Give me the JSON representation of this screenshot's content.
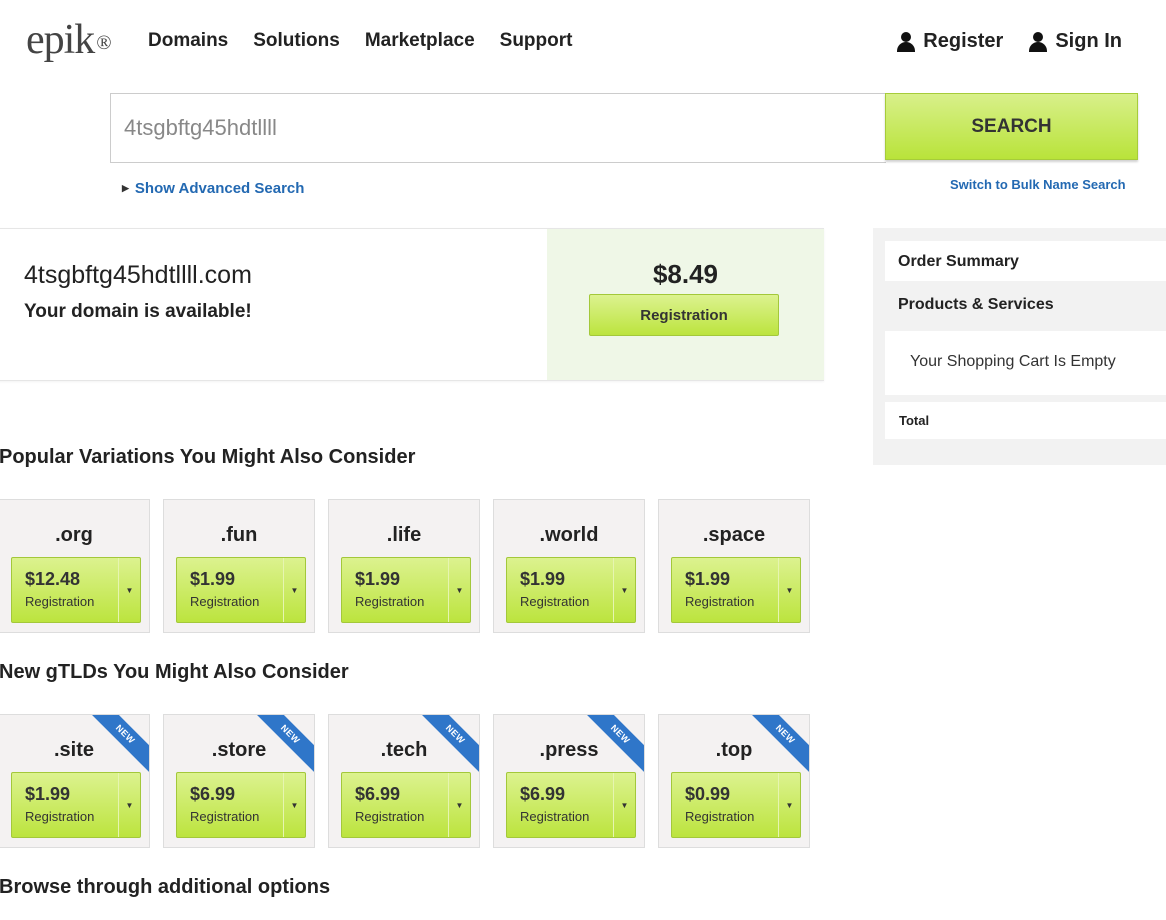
{
  "header": {
    "logo": "epik",
    "logo_mark": "®",
    "nav": [
      "Domains",
      "Solutions",
      "Marketplace",
      "Support"
    ],
    "register_label": "Register",
    "signin_label": "Sign In",
    "user_icon": "person-icon"
  },
  "search": {
    "value": "4tsgbftg45hdtllll",
    "button_label": "SEARCH",
    "advanced_label": "Show Advanced Search",
    "bulk_label": "Switch to Bulk Name Search"
  },
  "result": {
    "domain": "4tsgbftg45hdtllll.com",
    "status": "Your domain is available!",
    "price": "$8.49",
    "button_label": "Registration"
  },
  "order_summary": {
    "title": "Order Summary",
    "products_label": "Products & Services",
    "empty_text": "Your Shopping Cart Is Empty",
    "total_label": "Total"
  },
  "popular": {
    "title": "Popular Variations You Might Also Consider",
    "items": [
      {
        "tld": ".org",
        "price": "$12.48",
        "label": "Registration"
      },
      {
        "tld": ".fun",
        "price": "$1.99",
        "label": "Registration"
      },
      {
        "tld": ".life",
        "price": "$1.99",
        "label": "Registration"
      },
      {
        "tld": ".world",
        "price": "$1.99",
        "label": "Registration"
      },
      {
        "tld": ".space",
        "price": "$1.99",
        "label": "Registration"
      }
    ]
  },
  "gtlds": {
    "title": "New gTLDs You Might Also Consider",
    "badge": "NEW",
    "items": [
      {
        "tld": ".site",
        "price": "$1.99",
        "label": "Registration"
      },
      {
        "tld": ".store",
        "price": "$6.99",
        "label": "Registration"
      },
      {
        "tld": ".tech",
        "price": "$6.99",
        "label": "Registration"
      },
      {
        "tld": ".press",
        "price": "$6.99",
        "label": "Registration"
      },
      {
        "tld": ".top",
        "price": "$0.99",
        "label": "Registration"
      }
    ]
  },
  "browse": {
    "title": "Browse through additional options"
  },
  "colors": {
    "accent_green": "#bce43e",
    "link_blue": "#2369b2",
    "badge_blue": "#2f76c9",
    "result_bg": "#eff7e7"
  }
}
